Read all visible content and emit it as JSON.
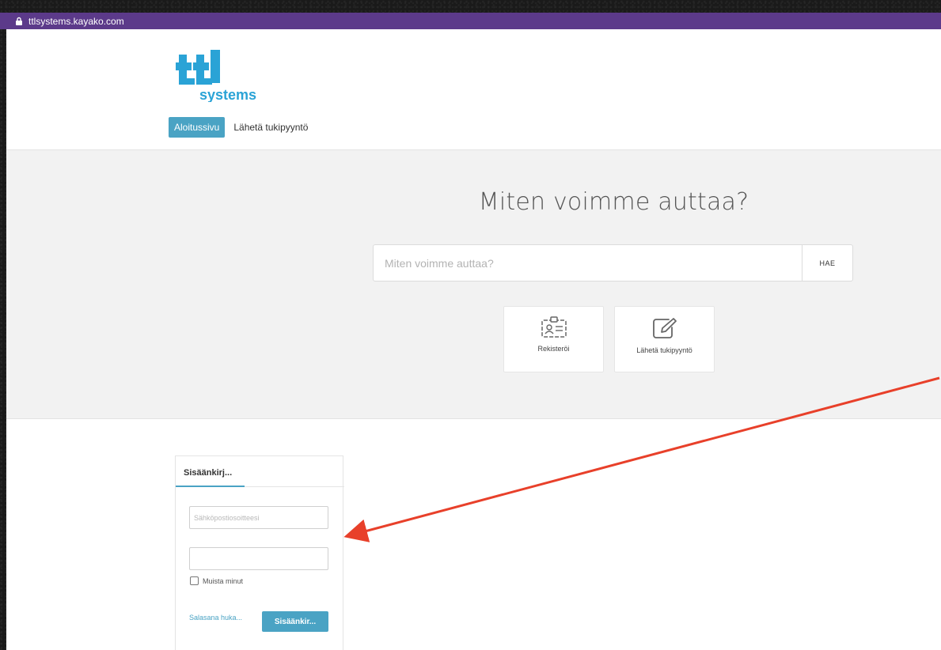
{
  "browser": {
    "url": "ttlsystems.kayako.com",
    "accent_color": "#5c3a8a"
  },
  "header": {
    "logo_text": "systems",
    "nav": {
      "home_label": "Aloitussivu",
      "submit_label": "Lähetä tukipyyntö"
    }
  },
  "hero": {
    "title": "Miten voimme auttaa?",
    "search_placeholder": "Miten voimme auttaa?",
    "search_button": "HAE",
    "cards": [
      {
        "label": "Rekisteröi",
        "icon": "id-card-icon"
      },
      {
        "label": "Lähetä tukipyyntö",
        "icon": "edit-icon"
      }
    ]
  },
  "login": {
    "tab_label": "Sisäänkirj...",
    "email_placeholder": "Sähköpostiosoitteesi",
    "remember_label": "Muista minut",
    "forgot_label": "Salasana huka...",
    "submit_label": "Sisäänkir..."
  },
  "colors": {
    "brand": "#4aa3c4",
    "annotation": "#e8402a"
  }
}
